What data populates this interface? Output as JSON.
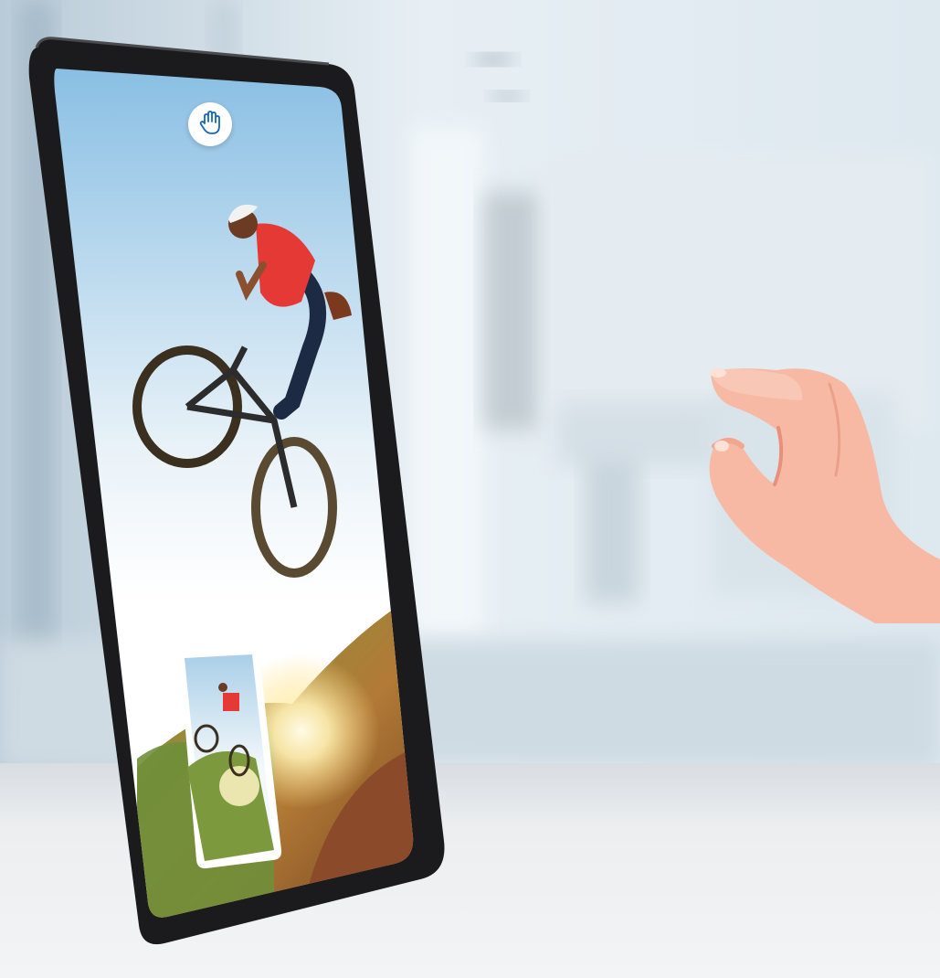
{
  "scene": {
    "description_label": "",
    "colors": {
      "room_light": "#e9f1f6",
      "room_mid": "#c9d7e0",
      "room_shadow": "#aebdc8",
      "table": "#eceef0",
      "tablet_frame": "#1b1b1d",
      "screen_sky_top": "#8fc3e6",
      "screen_sky_bottom": "#f4f8fb",
      "ground_green": "#6f8f3a",
      "ground_dirt": "#a0522d",
      "sun": "#fff3c4",
      "skin": "#f7b9a4",
      "skin_shadow": "#e8907a",
      "rider_shirt": "#e53935",
      "rider_pants": "#1d2a44",
      "accent_blue": "#1565c0"
    },
    "icons": {
      "gesture_badge": "palm-icon",
      "tablet": "tablet-device",
      "thumbnail": "screenshot-thumbnail",
      "hand": "pinch-gesture-hand"
    }
  }
}
